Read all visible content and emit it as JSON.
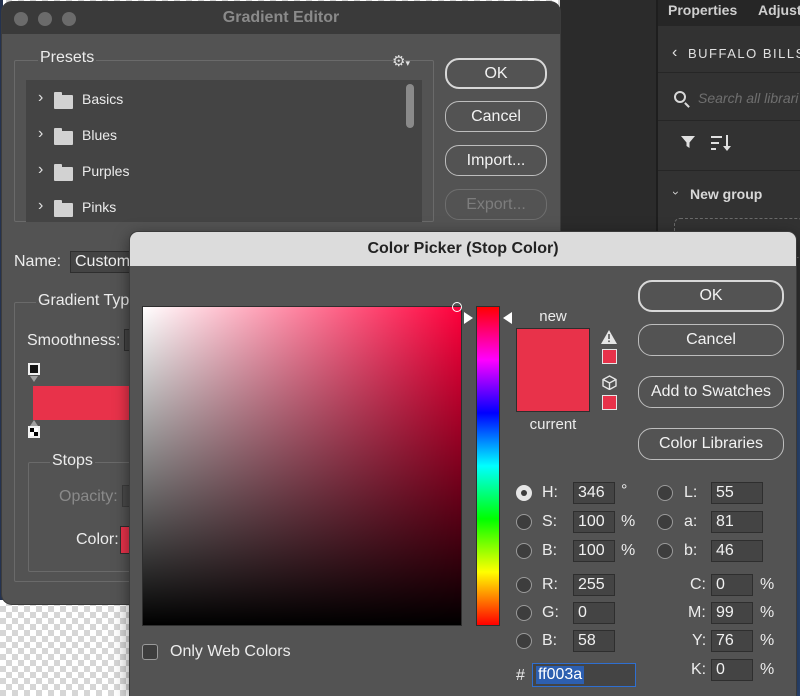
{
  "right_panel": {
    "tabs": [
      "Properties",
      "Adjust"
    ],
    "library_title": "BUFFALO BILLS",
    "search_placeholder": "Search all librari",
    "group_label": "New group"
  },
  "gradient_editor": {
    "title": "Gradient Editor",
    "presets_label": "Presets",
    "presets": [
      "Basics",
      "Blues",
      "Purples",
      "Pinks"
    ],
    "buttons": {
      "ok": "OK",
      "cancel": "Cancel",
      "import": "Import...",
      "export": "Export..."
    },
    "name_label": "Name:",
    "name_value": "Custom",
    "gradient_type_label": "Gradient Typ",
    "smoothness_label": "Smoothness:",
    "stops_label": "Stops",
    "opacity_label": "Opacity:",
    "color_label": "Color:",
    "stop_color": "#e8324a"
  },
  "color_picker": {
    "title": "Color Picker (Stop Color)",
    "new_label": "new",
    "current_label": "current",
    "new_color": "#e8324a",
    "current_color": "#e8324a",
    "buttons": {
      "ok": "OK",
      "cancel": "Cancel",
      "swatches": "Add to Swatches",
      "libraries": "Color Libraries"
    },
    "hsb": [
      {
        "label": "H:",
        "value": "346",
        "unit": "°",
        "selected": true
      },
      {
        "label": "S:",
        "value": "100",
        "unit": "%",
        "selected": false
      },
      {
        "label": "B:",
        "value": "100",
        "unit": "%",
        "selected": false
      }
    ],
    "lab": [
      {
        "label": "L:",
        "value": "55"
      },
      {
        "label": "a:",
        "value": "81"
      },
      {
        "label": "b:",
        "value": "46"
      }
    ],
    "rgb": [
      {
        "label": "R:",
        "value": "255"
      },
      {
        "label": "G:",
        "value": "0"
      },
      {
        "label": "B:",
        "value": "58"
      }
    ],
    "cmyk": [
      {
        "label": "C:",
        "value": "0",
        "unit": "%"
      },
      {
        "label": "M:",
        "value": "99",
        "unit": "%"
      },
      {
        "label": "Y:",
        "value": "76",
        "unit": "%"
      },
      {
        "label": "K:",
        "value": "0",
        "unit": "%"
      }
    ],
    "hex_label": "#",
    "hex_value": "ff003a",
    "web_colors_label": "Only Web Colors",
    "hue_degrees": 346
  }
}
